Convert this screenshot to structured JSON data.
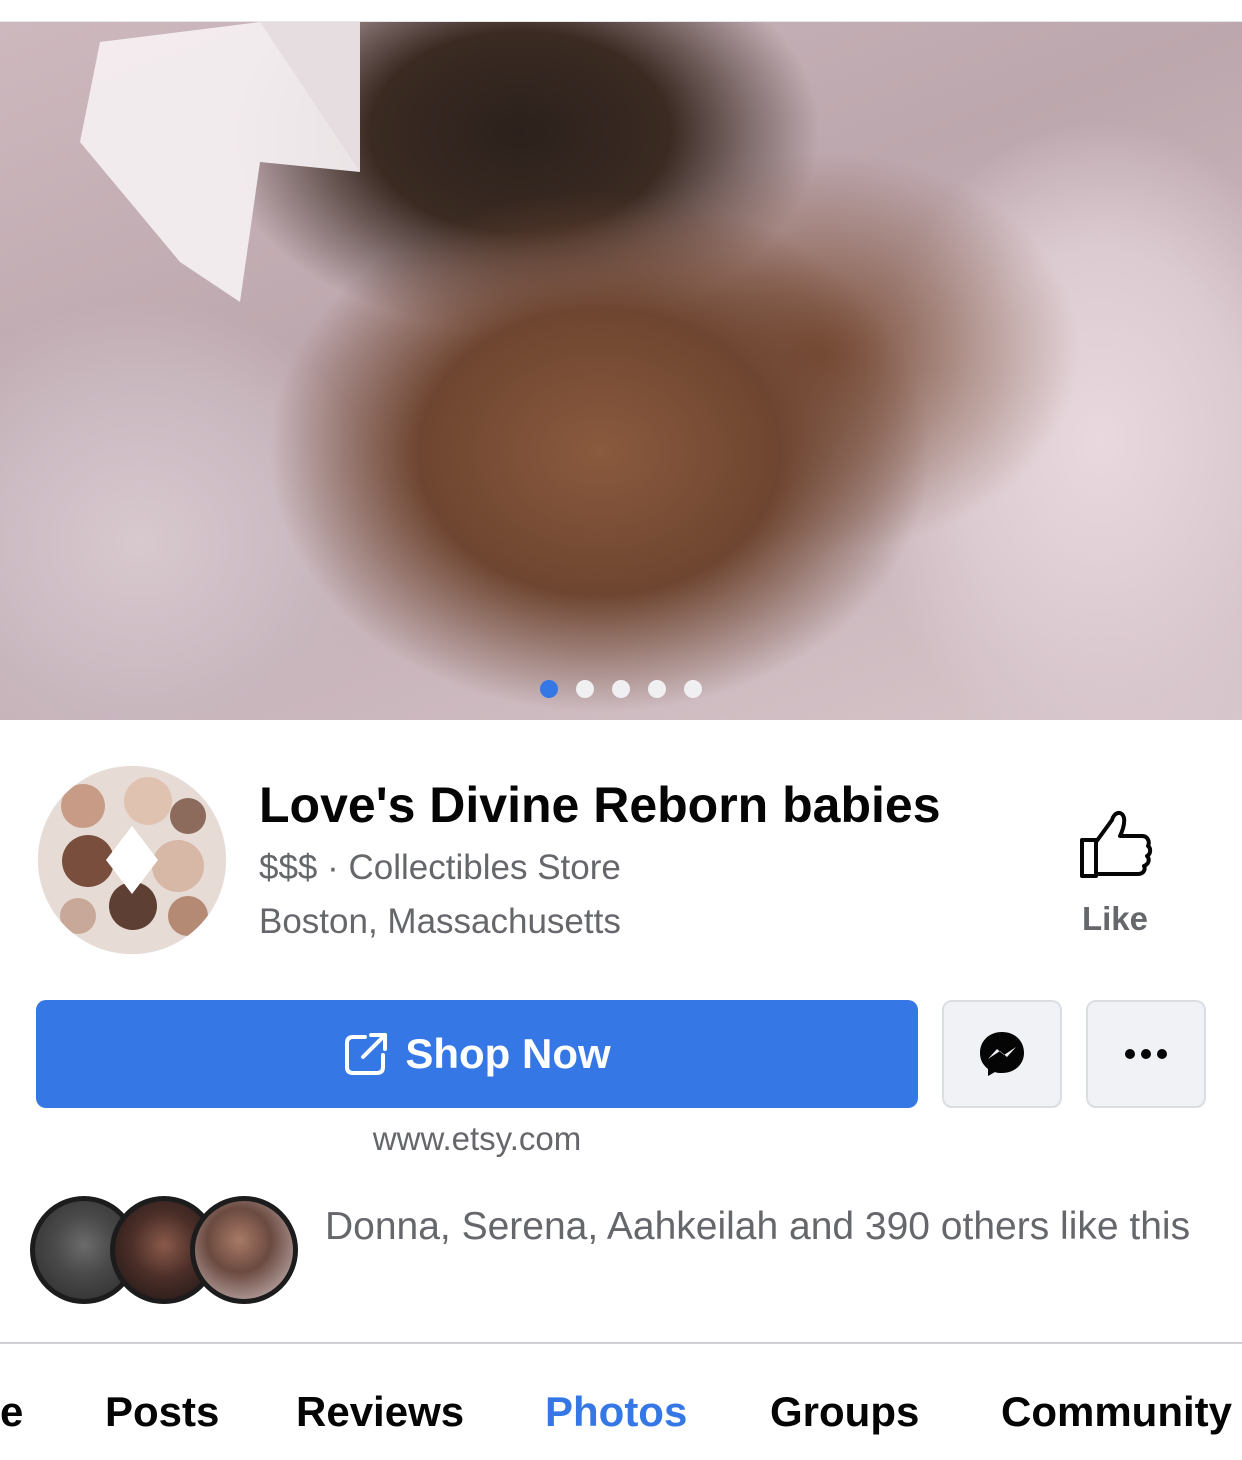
{
  "cover": {
    "carousel_total": 5,
    "carousel_active_index": 0
  },
  "page": {
    "name": "Love's Divine Reborn babies",
    "category": "$$$ · Collectibles Store",
    "location": "Boston, Massachusetts"
  },
  "like": {
    "label": "Like"
  },
  "actions": {
    "shop_now_label": "Shop Now",
    "website": "www.etsy.com"
  },
  "friends": {
    "text": "Donna, Serena, Aahkeilah and 390 others like this"
  },
  "tabs": [
    {
      "label": "e",
      "active": false
    },
    {
      "label": "Posts",
      "active": false
    },
    {
      "label": "Reviews",
      "active": false
    },
    {
      "label": "Photos",
      "active": true
    },
    {
      "label": "Groups",
      "active": false
    },
    {
      "label": "Community",
      "active": false
    }
  ],
  "colors": {
    "accent": "#3578e5",
    "secondary_text": "#65676b",
    "button_bg": "#f0f2f5"
  }
}
